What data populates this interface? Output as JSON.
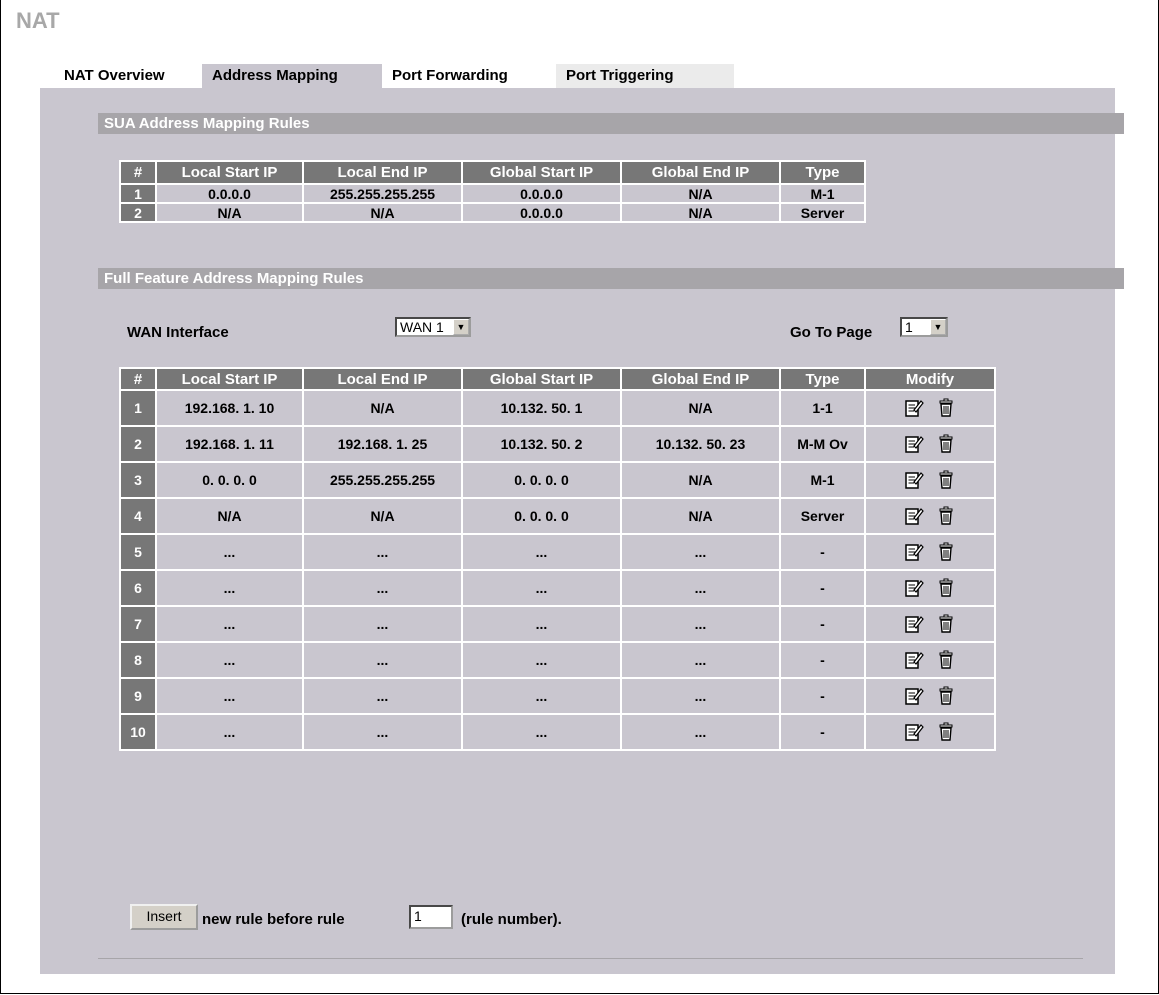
{
  "page_title": "NAT",
  "tabs": [
    {
      "label": "NAT Overview"
    },
    {
      "label": "Address Mapping"
    },
    {
      "label": "Port Forwarding"
    },
    {
      "label": "Port Triggering"
    }
  ],
  "sua": {
    "title": "SUA Address Mapping Rules",
    "columns": [
      "#",
      "Local Start IP",
      "Local End IP",
      "Global Start IP",
      "Global End IP",
      "Type"
    ],
    "rows": [
      [
        "1",
        "0.0.0.0",
        "255.255.255.255",
        "0.0.0.0",
        "N/A",
        "M-1"
      ],
      [
        "2",
        "N/A",
        "N/A",
        "0.0.0.0",
        "N/A",
        "Server"
      ]
    ]
  },
  "full_feature": {
    "title": "Full Feature Address Mapping Rules",
    "wan_label": "WAN Interface",
    "wan_value": "WAN 1",
    "goto_label": "Go To Page",
    "goto_value": "1",
    "columns": [
      "#",
      "Local Start IP",
      "Local End IP",
      "Global Start IP",
      "Global End IP",
      "Type",
      "Modify"
    ],
    "rows": [
      [
        "1",
        "192.168. 1. 10",
        "N/A",
        "10.132. 50. 1",
        "N/A",
        "1-1"
      ],
      [
        "2",
        "192.168. 1. 11",
        "192.168. 1. 25",
        "10.132. 50. 2",
        "10.132. 50. 23",
        "M-M Ov"
      ],
      [
        "3",
        "0. 0. 0. 0",
        "255.255.255.255",
        "0. 0. 0. 0",
        "N/A",
        "M-1"
      ],
      [
        "4",
        "N/A",
        "N/A",
        "0. 0. 0. 0",
        "N/A",
        "Server"
      ],
      [
        "5",
        "...",
        "...",
        "...",
        "...",
        "-"
      ],
      [
        "6",
        "...",
        "...",
        "...",
        "...",
        "-"
      ],
      [
        "7",
        "...",
        "...",
        "...",
        "...",
        "-"
      ],
      [
        "8",
        "...",
        "...",
        "...",
        "...",
        "-"
      ],
      [
        "9",
        "...",
        "...",
        "...",
        "...",
        "-"
      ],
      [
        "10",
        "...",
        "...",
        "...",
        "...",
        "-"
      ]
    ],
    "modify_icons": [
      "edit-icon",
      "delete-icon"
    ]
  },
  "insert": {
    "button_label": "Insert",
    "text_before": "new rule before rule",
    "rule_value": "1",
    "text_after": "(rule number)."
  }
}
